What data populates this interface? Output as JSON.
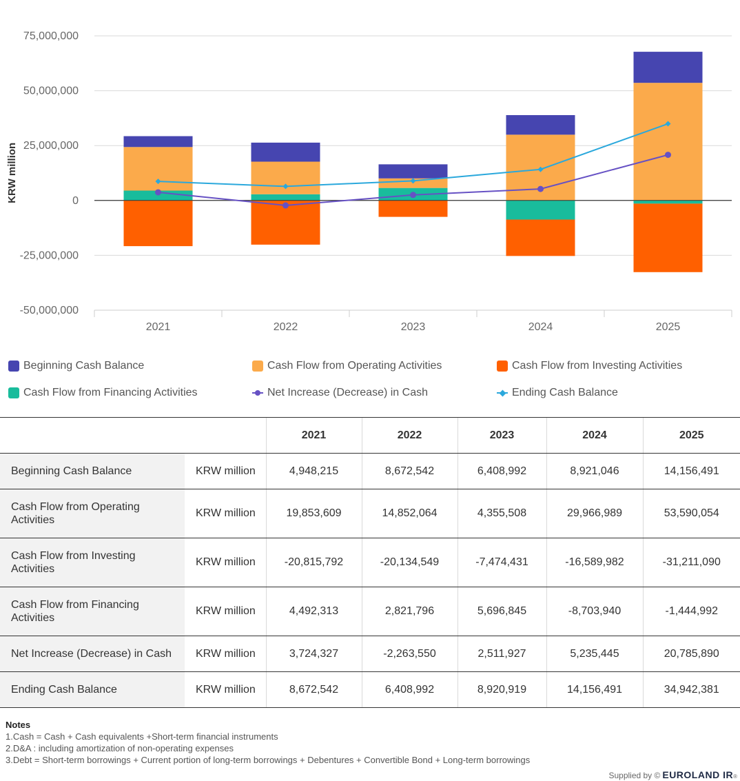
{
  "chart_data": {
    "type": "bar",
    "stacked": true,
    "ylabel": "KRW million",
    "ylim": [
      -50000000,
      75000000
    ],
    "yticks": [
      75000000,
      50000000,
      25000000,
      0,
      -25000000,
      -50000000
    ],
    "ytick_labels": [
      "75,000,000",
      "50,000,000",
      "25,000,000",
      "0",
      "-25,000,000",
      "-50,000,000"
    ],
    "categories": [
      "2021",
      "2022",
      "2023",
      "2024",
      "2025"
    ],
    "grid": true,
    "legend_position": "bottom",
    "series": [
      {
        "name": "Beginning Cash Balance",
        "kind": "bar",
        "color": "#4645b0",
        "values": [
          4948215,
          8672542,
          6408992,
          8921046,
          14156491
        ]
      },
      {
        "name": "Cash Flow from Operating Activities",
        "kind": "bar",
        "color": "#fbaa4b",
        "values": [
          19853609,
          14852064,
          4355508,
          29966989,
          53590054
        ]
      },
      {
        "name": "Cash Flow from Investing Activities",
        "kind": "bar",
        "color": "#ff6000",
        "values": [
          -20815792,
          -20134549,
          -7474431,
          -16589982,
          -31211090
        ]
      },
      {
        "name": "Cash Flow from Financing Activities",
        "kind": "bar",
        "color": "#19bc9c",
        "values": [
          4492313,
          2821796,
          5696845,
          -8703940,
          -1444992
        ]
      },
      {
        "name": "Net Increase (Decrease) in Cash",
        "kind": "line",
        "marker": "circle",
        "color": "#6651c4",
        "values": [
          3724327,
          -2263550,
          2511927,
          5235445,
          20785890
        ]
      },
      {
        "name": "Ending Cash Balance",
        "kind": "line",
        "marker": "diamond",
        "color": "#2aa8dc",
        "values": [
          8672542,
          6408992,
          8920919,
          14156491,
          34942381
        ]
      }
    ]
  },
  "legend": {
    "items": [
      {
        "label": "Beginning Cash Balance",
        "color": "#4645b0",
        "type": "swatch"
      },
      {
        "label": "Cash Flow from Operating Activities",
        "color": "#fbaa4b",
        "type": "swatch"
      },
      {
        "label": "Cash Flow from Investing Activities",
        "color": "#ff6000",
        "type": "swatch"
      },
      {
        "label": "Cash Flow from Financing Activities",
        "color": "#19bc9c",
        "type": "swatch"
      },
      {
        "label": "Net Increase (Decrease) in Cash",
        "color": "#6651c4",
        "type": "line-circle"
      },
      {
        "label": "Ending Cash Balance",
        "color": "#2aa8dc",
        "type": "line-diamond"
      }
    ]
  },
  "table": {
    "years": [
      "2021",
      "2022",
      "2023",
      "2024",
      "2025"
    ],
    "rows": [
      {
        "label": "Beginning Cash Balance",
        "unit": "KRW million",
        "values": [
          "4,948,215",
          "8,672,542",
          "6,408,992",
          "8,921,046",
          "14,156,491"
        ]
      },
      {
        "label": "Cash Flow from Operating Activities",
        "unit": "KRW million",
        "values": [
          "19,853,609",
          "14,852,064",
          "4,355,508",
          "29,966,989",
          "53,590,054"
        ]
      },
      {
        "label": "Cash Flow from Investing Activities",
        "unit": "KRW million",
        "values": [
          "-20,815,792",
          "-20,134,549",
          "-7,474,431",
          "-16,589,982",
          "-31,211,090"
        ]
      },
      {
        "label": "Cash Flow from Financing Activities",
        "unit": "KRW million",
        "values": [
          "4,492,313",
          "2,821,796",
          "5,696,845",
          "-8,703,940",
          "-1,444,992"
        ]
      },
      {
        "label": "Net Increase (Decrease) in Cash",
        "unit": "KRW million",
        "values": [
          "3,724,327",
          "-2,263,550",
          "2,511,927",
          "5,235,445",
          "20,785,890"
        ]
      },
      {
        "label": "Ending Cash Balance",
        "unit": "KRW million",
        "values": [
          "8,672,542",
          "6,408,992",
          "8,920,919",
          "14,156,491",
          "34,942,381"
        ]
      }
    ]
  },
  "notes": {
    "title": "Notes",
    "lines": [
      "1.Cash = Cash + Cash equivalents +Short-term financial instruments",
      "2.D&A : including amortization of non-operating expenses",
      "3.Debt = Short-term borrowings + Current portion of long-term borrowings + Debentures + Convertible Bond + Long-term borrowings"
    ]
  },
  "footer": {
    "supplied_by": "Supplied by ©",
    "brand": "EUROLAND IR",
    "registered": "®"
  }
}
